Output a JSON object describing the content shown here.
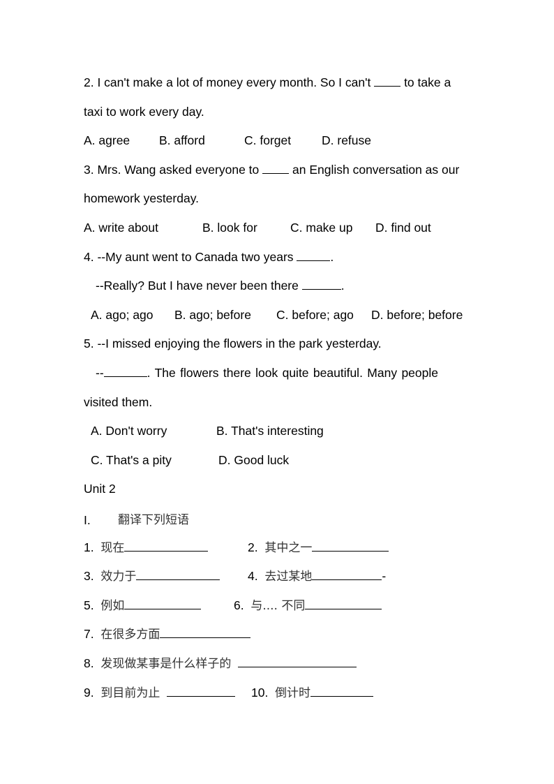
{
  "questions": [
    {
      "stem_line1_a": "2. I can't make a lot of money every month. So I can't ",
      "stem_line1_b": " to take a",
      "stem_line2": "taxi to work every day.",
      "options": [
        "A. agree",
        "B. afford",
        "C. forget",
        "D. refuse"
      ]
    },
    {
      "stem_line1_a": "3. Mrs. Wang asked everyone to ",
      "stem_line1_b": " an English conversation as our",
      "stem_line2": "homework yesterday.",
      "options": [
        "A. write about",
        "B. look for",
        "C. make up",
        "D. find out"
      ]
    },
    {
      "stem_line1_a": "4. --My aunt went to Canada two years ",
      "stem_line1_b": ".",
      "stem_line2_a": "--Really? But I have never been there ",
      "stem_line2_b": ".",
      "options": [
        "A. ago; ago",
        "B. ago; before",
        "C. before; ago",
        "D. before; before"
      ]
    },
    {
      "stem_line1": "5. --I missed enjoying the flowers in the park yesterday.",
      "stem_line2_a": "--",
      "stem_line2_b": ". The flowers there look quite beautiful. Many people",
      "stem_line3": "visited them.",
      "options": [
        "A. Don't worry",
        "B. That's interesting",
        "C. That's a pity",
        "D. Good luck"
      ]
    }
  ],
  "unit": {
    "title": "Unit 2",
    "section_number": "I.",
    "section_title": "翻译下列短语",
    "items": [
      {
        "num": "1.",
        "text": "现在"
      },
      {
        "num": "2.",
        "text": "其中之一"
      },
      {
        "num": "3.",
        "text": "效力于"
      },
      {
        "num": "4.",
        "text": "去过某地",
        "suffix": "-"
      },
      {
        "num": "5.",
        "text": "例如"
      },
      {
        "num": "6.",
        "text": "与.... 不同"
      },
      {
        "num": "7.",
        "text": "在很多方面"
      },
      {
        "num": "8.",
        "text": "发现做某事是什么样子的"
      },
      {
        "num": "9.",
        "text": "到目前为止"
      },
      {
        "num": "10.",
        "text": "倒计时"
      }
    ]
  }
}
